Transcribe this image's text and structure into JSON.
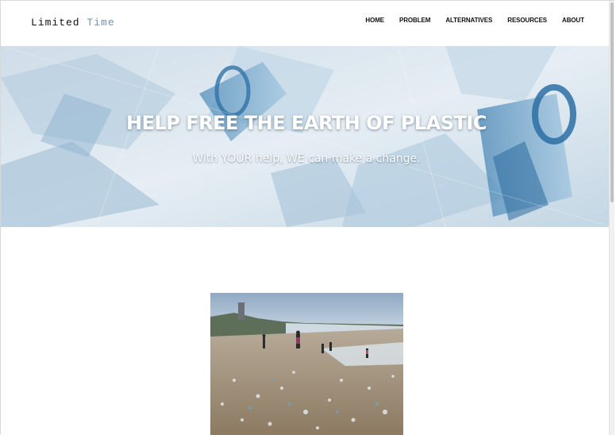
{
  "brand": {
    "word1": "Limited",
    "word2": "Time"
  },
  "nav": {
    "items": [
      "HOME",
      "PROBLEM",
      "ALTERNATIVES",
      "RESOURCES",
      "ABOUT"
    ]
  },
  "hero": {
    "title": "HELP FREE THE EARTH OF PLASTIC",
    "subtitle": "With YOUR help, WE can make a change.",
    "image": "crumpled-plastic-bottles-photo"
  },
  "content": {
    "image": "plastic-polluted-beach-photo"
  },
  "colors": {
    "brand_accent": "#6f8fb5",
    "hero_tint": "#9fc0d9",
    "text": "#111111"
  }
}
